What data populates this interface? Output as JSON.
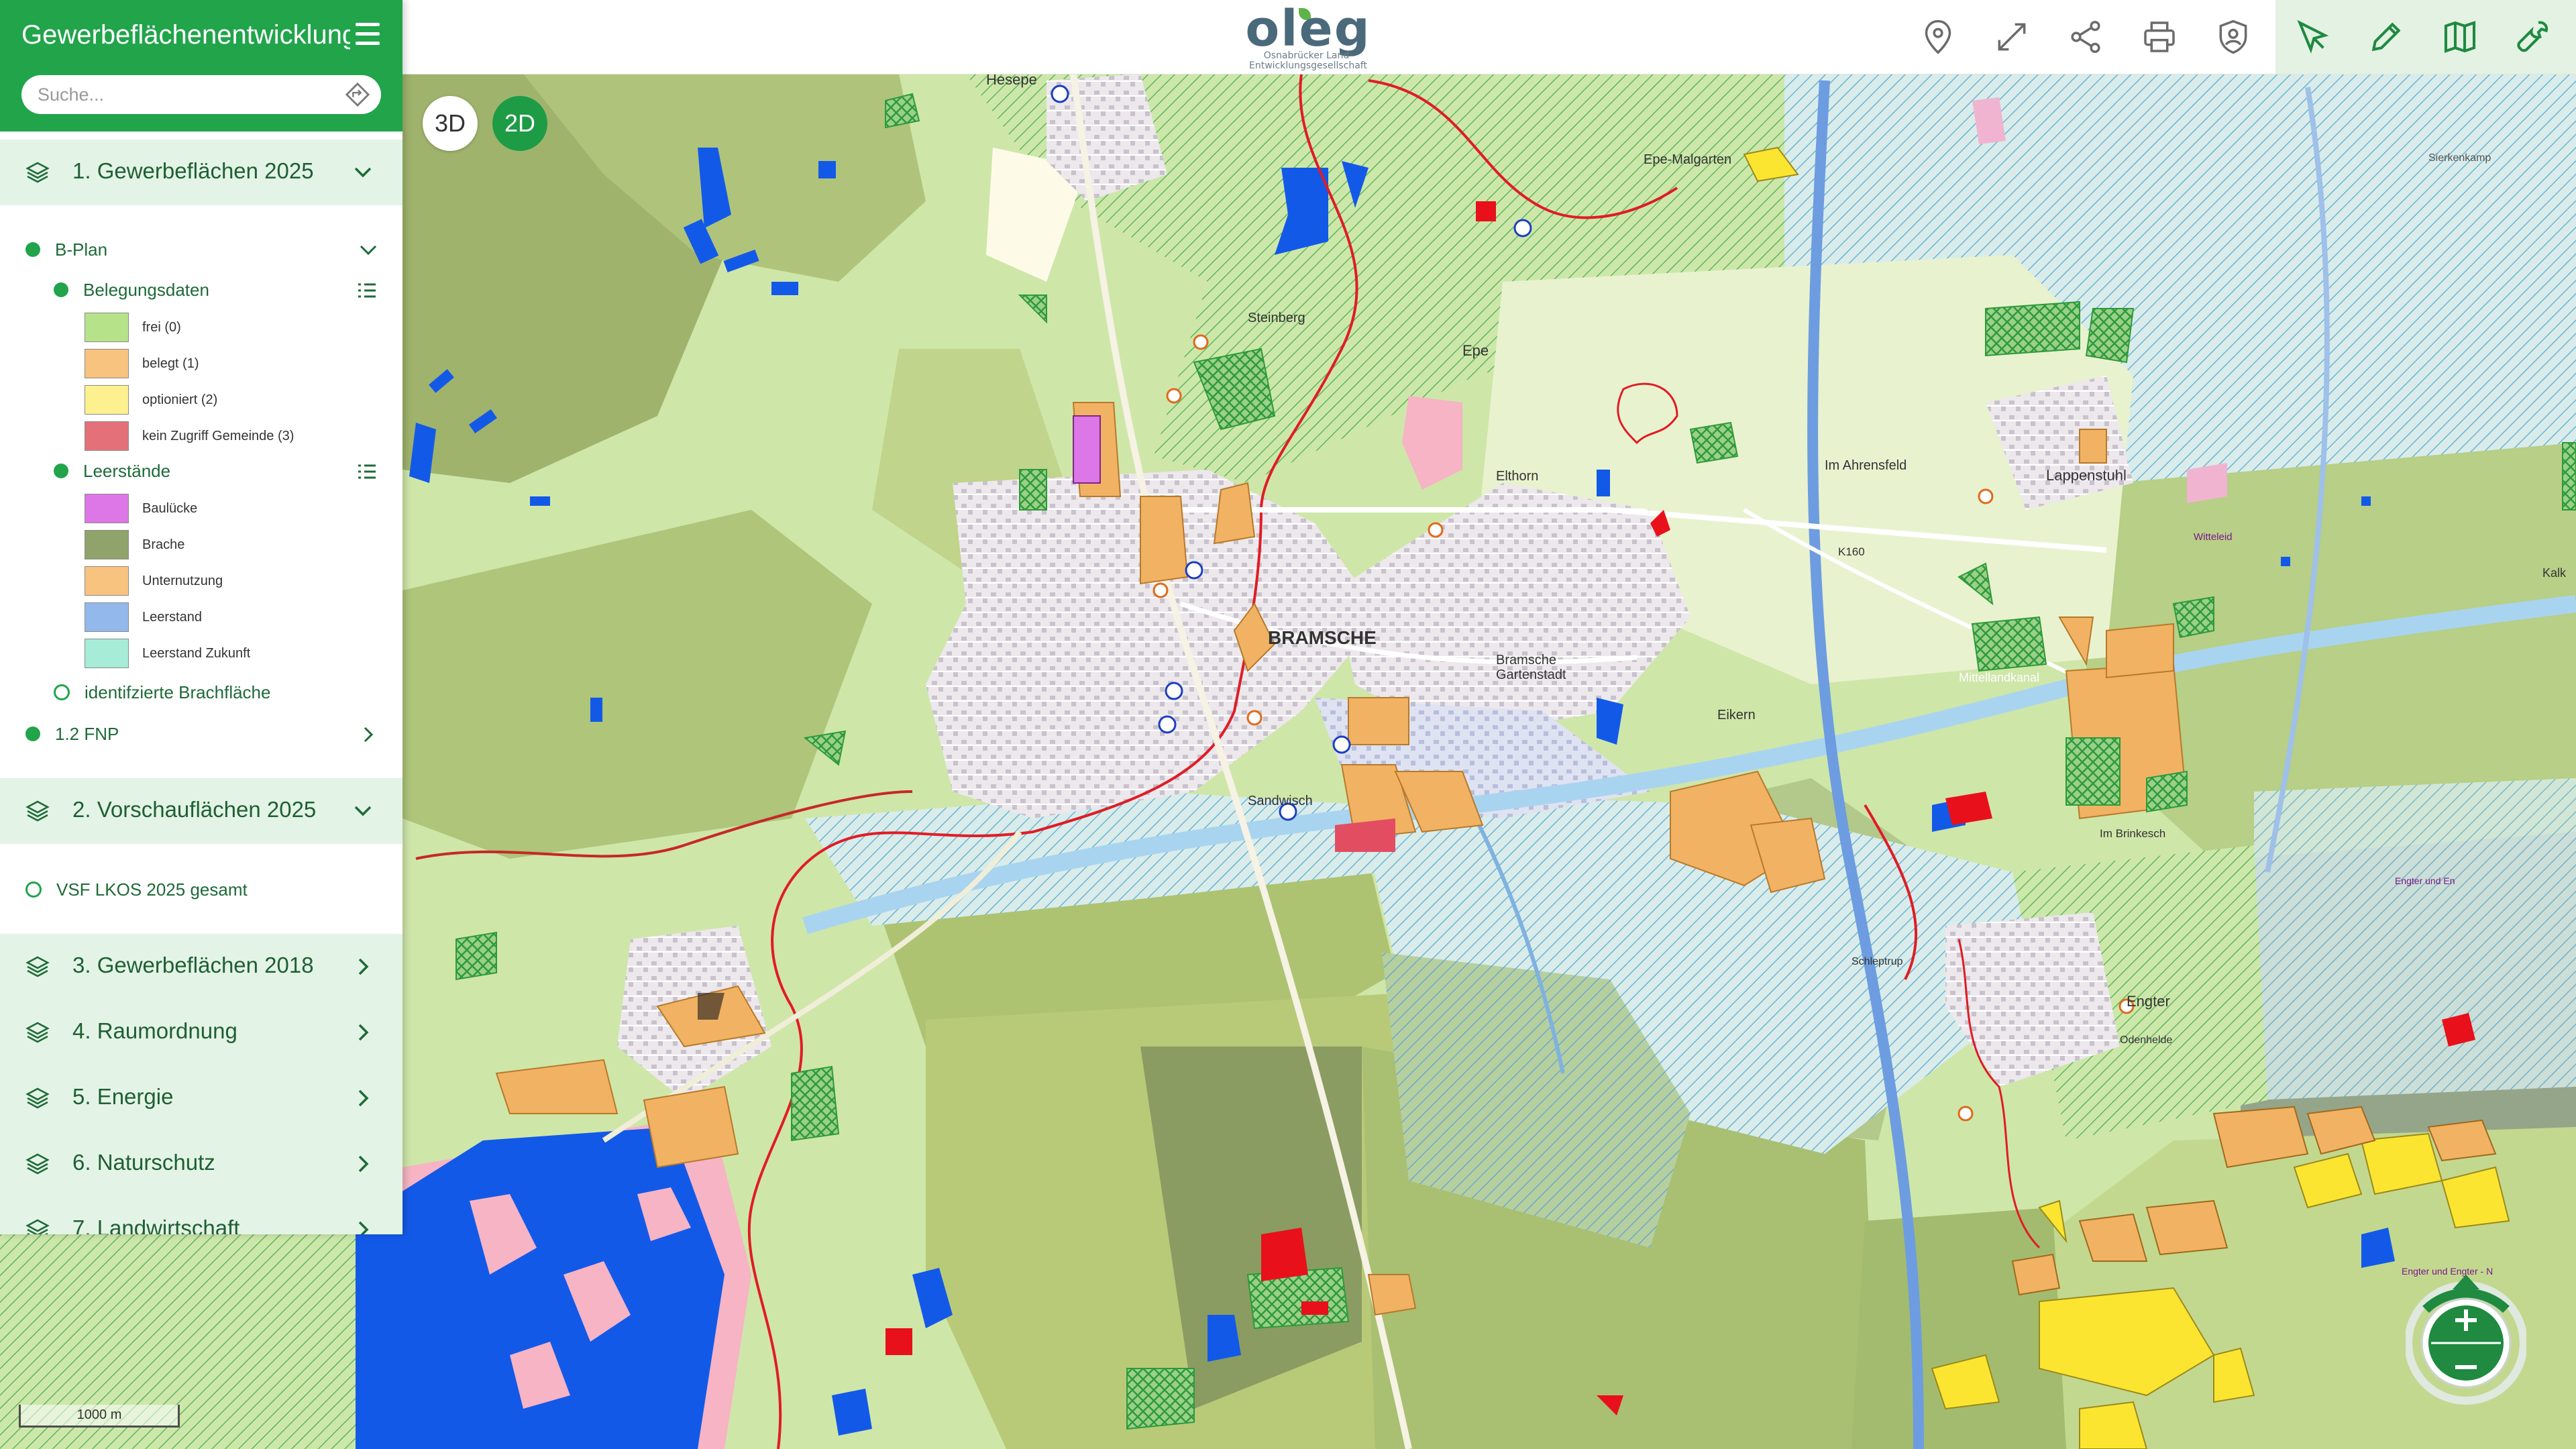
{
  "app": {
    "title": "Gewerbeflächenentwicklung",
    "logo_word": "oleg",
    "logo_subtitle_1": "Osnabrücker Land-",
    "logo_subtitle_2": "Entwicklungsgesellschaft",
    "brand_color": "#21a44a"
  },
  "search": {
    "placeholder": "Suche..."
  },
  "categories": [
    {
      "label": "1. Gewerbeflächen 2025",
      "expanded": true
    },
    {
      "label": "2. Vorschauflächen 2025",
      "expanded": true
    },
    {
      "label": "3. Gewerbeflächen 2018",
      "expanded": false
    },
    {
      "label": "4. Raumordnung",
      "expanded": false
    },
    {
      "label": "5. Energie",
      "expanded": false
    },
    {
      "label": "6. Naturschutz",
      "expanded": false
    },
    {
      "label": "7. Landwirtschaft",
      "expanded": false
    }
  ],
  "layers": {
    "bplan": "B-Plan",
    "belegungsdaten": "Belegungsdaten",
    "belegung_legend": [
      {
        "label": "frei (0)",
        "color": "#b6e38a"
      },
      {
        "label": "belegt (1)",
        "color": "#f8c37e"
      },
      {
        "label": "optioniert (2)",
        "color": "#fdf18f"
      },
      {
        "label": "kein Zugriff Gemeinde (3)",
        "color": "#e4707a"
      }
    ],
    "leerstaende": "Leerstände",
    "leerstand_legend": [
      {
        "label": "Baulücke",
        "color": "#dd76e6"
      },
      {
        "label": "Brache",
        "color": "#8fa36a"
      },
      {
        "label": "Unternutzung",
        "color": "#f8c37e"
      },
      {
        "label": "Leerstand",
        "color": "#93b9ec"
      },
      {
        "label": "Leerstand Zukunft",
        "color": "#a6ecd6"
      }
    ],
    "brachflaeche": "identifzierte Brachfläche",
    "fnp": "1.2 FNP",
    "vsf": "VSF LKOS 2025 gesamt"
  },
  "map": {
    "view_3d": "3D",
    "view_2d": "2D",
    "active_view": "2D",
    "scale": "1000 m",
    "labels": {
      "bramsche": "BRAMSCHE",
      "bramsche_gartenstadt_1": "Bramsche",
      "bramsche_gartenstadt_2": "Gartenstadt",
      "epe": "Epe",
      "epe_malgarten": "Epe-Malgarten",
      "lappenstuhl": "Lappenstuhl",
      "eikern": "Eikern",
      "elthorn": "Elthorn",
      "im_ahrensfeld": "Im Ahrensfeld",
      "witteleid": "Witteleid",
      "engter": "Engter",
      "sandwisch": "Sandwisch",
      "hesepe": "Hesepe",
      "k160": "K160",
      "kalk": "Kalk",
      "steinberg": "Steinberg",
      "kanal": "Mittellandkanal",
      "im_brinkesch": "Im Brinkesch",
      "schleptrup": "Schleptrup",
      "engter_en": "Engter und En",
      "engter_engter": "Engter und Engter - N",
      "odenhelde": "Odenhelde",
      "sierkenkamp": "Sierkenkamp"
    }
  },
  "toolbar": {
    "tools": [
      "location-pin",
      "fullscreen-arrows",
      "share",
      "print",
      "user-shield"
    ],
    "tools_right": [
      "select-cursor",
      "edit-pencil",
      "map-book",
      "wrench"
    ]
  },
  "colors": {
    "map_green_light": "#cfe6a9",
    "map_green_mid": "#afcb7a",
    "map_olive": "#97a760",
    "map_blue_hatch": "#8dbfe6",
    "map_water": "#1359e8",
    "map_pink": "#f6b4c4",
    "map_orange": "#f2b264",
    "map_red": "#e8101b"
  }
}
